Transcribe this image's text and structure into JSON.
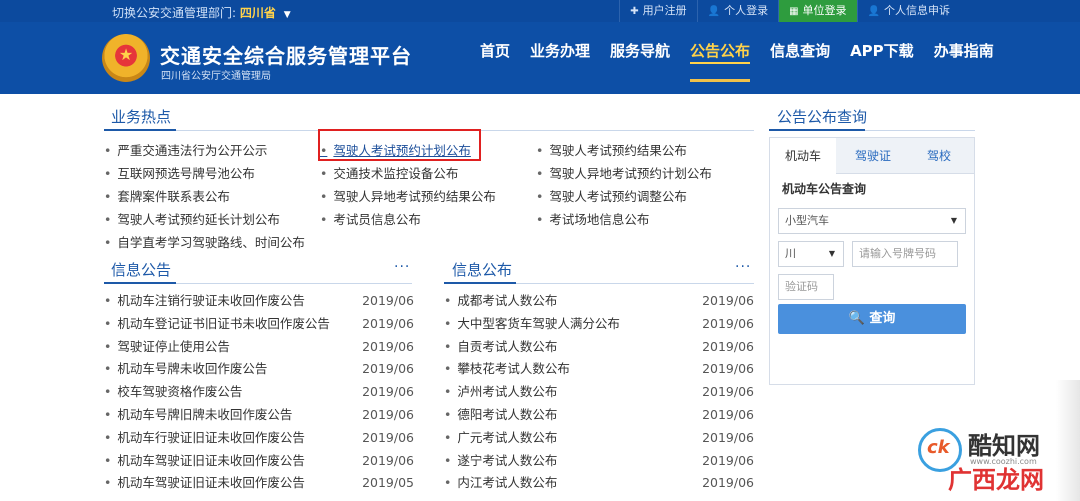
{
  "topbar": {
    "dept_label": "切换公安交通管理部门:",
    "dept_value": "四川省",
    "links": [
      "用户注册",
      "个人登录",
      "单位登录",
      "个人信息申诉"
    ]
  },
  "header": {
    "title": "交通安全综合服务管理平台",
    "subtitle": "四川省公安厅交通管理局",
    "nav": [
      "首页",
      "业务办理",
      "服务导航",
      "公告公布",
      "信息查询",
      "APP下载",
      "办事指南"
    ],
    "active_nav": "公告公布"
  },
  "hot": {
    "title": "业务热点",
    "col1": [
      "严重交通违法行为公开公示",
      "互联网预选号牌号池公布",
      "套牌案件联系表公布",
      "驾驶人考试预约延长计划公布",
      "自学直考学习驾驶路线、时间公布"
    ],
    "col2": [
      "驾驶人考试预约计划公布",
      "交通技术监控设备公布",
      "驾驶人异地考试预约结果公布",
      "考试员信息公布"
    ],
    "col3": [
      "驾驶人考试预约结果公布",
      "驾驶人异地考试预约计划公布",
      "驾驶人考试预约调整公布",
      "考试场地信息公布"
    ]
  },
  "info_notice": {
    "title": "信息公告",
    "more": "···",
    "rows": [
      {
        "t": "机动车注销行驶证未收回作废公告",
        "d": "2019/06"
      },
      {
        "t": "机动车登记证书旧证书未收回作废公告",
        "d": "2019/06"
      },
      {
        "t": "驾驶证停止使用公告",
        "d": "2019/06"
      },
      {
        "t": "机动车号牌未收回作废公告",
        "d": "2019/06"
      },
      {
        "t": "校车驾驶资格作废公告",
        "d": "2019/06"
      },
      {
        "t": "机动车号牌旧牌未收回作废公告",
        "d": "2019/06"
      },
      {
        "t": "机动车行驶证旧证未收回作废公告",
        "d": "2019/06"
      },
      {
        "t": "机动车驾驶证旧证未收回作废公告",
        "d": "2019/06"
      },
      {
        "t": "机动车驾驶证旧证未收回作废公告",
        "d": "2019/05"
      }
    ]
  },
  "info_publish": {
    "title": "信息公布",
    "more": "···",
    "rows": [
      {
        "t": "成都考试人数公布",
        "d": "2019/06"
      },
      {
        "t": "大中型客货车驾驶人满分公布",
        "d": "2019/06"
      },
      {
        "t": "自贡考试人数公布",
        "d": "2019/06"
      },
      {
        "t": "攀枝花考试人数公布",
        "d": "2019/06"
      },
      {
        "t": "泸州考试人数公布",
        "d": "2019/06"
      },
      {
        "t": "德阳考试人数公布",
        "d": "2019/06"
      },
      {
        "t": "广元考试人数公布",
        "d": "2019/06"
      },
      {
        "t": "遂宁考试人数公布",
        "d": "2019/06"
      },
      {
        "t": "内江考试人数公布",
        "d": "2019/06"
      }
    ]
  },
  "query": {
    "title": "公告公布查询",
    "tabs": [
      "机动车",
      "驾驶证",
      "驾校"
    ],
    "label": "机动车公告查询",
    "vehicle_type": "小型汽车",
    "province": "川",
    "plate_placeholder": "请输入号牌号码",
    "captcha_placeholder": "验证码",
    "button": "查询"
  },
  "watermark": {
    "name": "酷知网",
    "url": "www.coozhi.com",
    "name2": "广西龙网"
  },
  "colors": {
    "header_bg": "#0d4fa6",
    "accent": "#ffd24a",
    "link": "#1d59a8",
    "highlight_box": "#e02020",
    "button": "#4a90dd"
  }
}
